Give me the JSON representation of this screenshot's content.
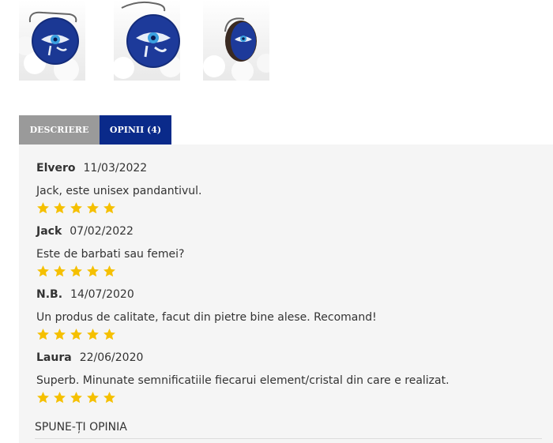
{
  "gallery": {
    "images": [
      {
        "alt": "eye-of-horus-pendant-front"
      },
      {
        "alt": "eye-of-horus-pendant-closeup"
      },
      {
        "alt": "eye-of-horus-pendant-side"
      }
    ]
  },
  "tabs": [
    {
      "label": "DESCRIERE",
      "active": false
    },
    {
      "label": "OPINII (4)",
      "active": true
    }
  ],
  "colors": {
    "tab_active": "#0a2a8a",
    "tab_inactive": "#9a9a9a",
    "star": "#f5c000",
    "panel_bg": "#f5f5f5"
  },
  "reviews": [
    {
      "author": "Elvero",
      "date": "11/03/2022",
      "text": "Jack, este unisex pandantivul.",
      "rating": 5
    },
    {
      "author": "Jack",
      "date": "07/02/2022",
      "text": "Este de barbati sau femei?",
      "rating": 5
    },
    {
      "author": "N.B.",
      "date": "14/07/2020",
      "text": "Un produs de calitate, facut din pietre bine alese. Recomand!",
      "rating": 5
    },
    {
      "author": "Laura",
      "date": "22/06/2020",
      "text": "Superb. Minunate semnificatiile fiecarui element/cristal din care e realizat.",
      "rating": 5
    }
  ],
  "write_review_label": "SPUNE-ȚI OPINIA"
}
